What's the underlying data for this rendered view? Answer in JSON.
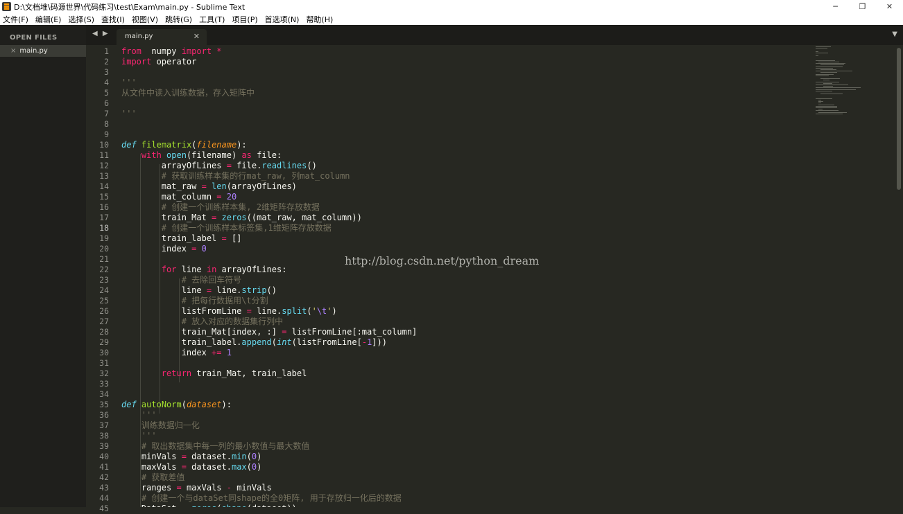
{
  "window": {
    "title": "D:\\文档堆\\码源世界\\代码练习\\test\\Exam\\main.py - Sublime Text",
    "controls": {
      "minimize": "─",
      "restore": "❐",
      "close": "✕"
    }
  },
  "menu": [
    "文件(F)",
    "编辑(E)",
    "选择(S)",
    "查找(I)",
    "视图(V)",
    "跳转(G)",
    "工具(T)",
    "项目(P)",
    "首选项(N)",
    "帮助(H)"
  ],
  "sidebar": {
    "header": "OPEN FILES",
    "files": [
      {
        "close": "×",
        "name": "main.py"
      }
    ]
  },
  "tabs": {
    "nav": "◀ ▶",
    "active": {
      "label": "main.py",
      "close": "✕"
    },
    "dropdown": "▼"
  },
  "editor": {
    "active_line": 18,
    "watermark": "http://blog.csdn.net/python_dream",
    "lines": [
      [
        [
          "kw",
          "from"
        ],
        [
          "",
          "  numpy "
        ],
        [
          "kw",
          "import"
        ],
        [
          "kw",
          " *"
        ]
      ],
      [
        [
          "kw",
          "import"
        ],
        [
          "",
          " operator"
        ]
      ],
      [],
      [
        [
          "doc",
          "'''"
        ]
      ],
      [
        [
          "doc",
          "从文件中读入训练数据，存入矩阵中"
        ]
      ],
      [],
      [
        [
          "doc",
          "'''"
        ]
      ],
      [],
      [],
      [
        [
          "def",
          "def"
        ],
        [
          "",
          " "
        ],
        [
          "fn",
          "filematrix"
        ],
        [
          "",
          "("
        ],
        [
          "param",
          "filename"
        ],
        [
          "",
          "):"
        ]
      ],
      [
        [
          "",
          "    "
        ],
        [
          "kw",
          "with"
        ],
        [
          "",
          " "
        ],
        [
          "bi",
          "open"
        ],
        [
          "",
          "(filename) "
        ],
        [
          "kw",
          "as"
        ],
        [
          "",
          " file:"
        ]
      ],
      [
        [
          "",
          "        arrayOfLines "
        ],
        [
          "kw",
          "="
        ],
        [
          "",
          " file."
        ],
        [
          "bi",
          "readlines"
        ],
        [
          "",
          "()"
        ]
      ],
      [
        [
          "",
          "        "
        ],
        [
          "cmt",
          "# 获取训练样本集的行mat_raw, 列mat_column"
        ]
      ],
      [
        [
          "",
          "        mat_raw "
        ],
        [
          "kw",
          "="
        ],
        [
          "",
          " "
        ],
        [
          "bi",
          "len"
        ],
        [
          "",
          "(arrayOfLines)"
        ]
      ],
      [
        [
          "",
          "        mat_column "
        ],
        [
          "kw",
          "="
        ],
        [
          "",
          " "
        ],
        [
          "num",
          "20"
        ]
      ],
      [
        [
          "",
          "        "
        ],
        [
          "cmt",
          "# 创建一个训练样本集, 2维矩阵存放数据"
        ]
      ],
      [
        [
          "",
          "        train_Mat "
        ],
        [
          "kw",
          "="
        ],
        [
          "",
          " "
        ],
        [
          "bi",
          "zeros"
        ],
        [
          "",
          "((mat_raw, mat_column))"
        ]
      ],
      [
        [
          "",
          "        "
        ],
        [
          "cmt",
          "# 创建一个训练样本标签集,1维矩阵存放数据"
        ]
      ],
      [
        [
          "",
          "        train_label "
        ],
        [
          "kw",
          "="
        ],
        [
          "",
          " []"
        ]
      ],
      [
        [
          "",
          "        index "
        ],
        [
          "kw",
          "="
        ],
        [
          "",
          " "
        ],
        [
          "num",
          "0"
        ]
      ],
      [],
      [
        [
          "",
          "        "
        ],
        [
          "kw",
          "for"
        ],
        [
          "",
          " line "
        ],
        [
          "kw",
          "in"
        ],
        [
          "",
          " arrayOfLines:"
        ]
      ],
      [
        [
          "",
          "            "
        ],
        [
          "cmt",
          "# 去除回车符号"
        ]
      ],
      [
        [
          "",
          "            line "
        ],
        [
          "kw",
          "="
        ],
        [
          "",
          " line."
        ],
        [
          "bi",
          "strip"
        ],
        [
          "",
          "()"
        ]
      ],
      [
        [
          "",
          "            "
        ],
        [
          "cmt",
          "# 把每行数据用\\t分割"
        ]
      ],
      [
        [
          "",
          "            listFromLine "
        ],
        [
          "kw",
          "="
        ],
        [
          "",
          " line."
        ],
        [
          "bi",
          "split"
        ],
        [
          "",
          "("
        ],
        [
          "str",
          "'"
        ],
        [
          "esc",
          "\\t"
        ],
        [
          "str",
          "'"
        ],
        [
          "",
          ")"
        ]
      ],
      [
        [
          "",
          "            "
        ],
        [
          "cmt",
          "# 放入对应的数据集行列中"
        ]
      ],
      [
        [
          "",
          "            train_Mat[index, :] "
        ],
        [
          "kw",
          "="
        ],
        [
          "",
          " listFromLine[:mat_column]"
        ]
      ],
      [
        [
          "",
          "            train_label."
        ],
        [
          "bi",
          "append"
        ],
        [
          "",
          "("
        ],
        [
          "def",
          "int"
        ],
        [
          "",
          "(listFromLine["
        ],
        [
          "kw",
          "-"
        ],
        [
          "num",
          "1"
        ],
        [
          "",
          "]))"
        ]
      ],
      [
        [
          "",
          "            index "
        ],
        [
          "kw",
          "+="
        ],
        [
          "",
          " "
        ],
        [
          "num",
          "1"
        ]
      ],
      [],
      [
        [
          "",
          "        "
        ],
        [
          "kw",
          "return"
        ],
        [
          "",
          " train_Mat, train_label"
        ]
      ],
      [],
      [],
      [
        [
          "def",
          "def"
        ],
        [
          "",
          " "
        ],
        [
          "fn",
          "autoNorm"
        ],
        [
          "",
          "("
        ],
        [
          "param",
          "dataset"
        ],
        [
          "",
          "):"
        ]
      ],
      [
        [
          "",
          "    "
        ],
        [
          "doc",
          "'''"
        ]
      ],
      [
        [
          "",
          "    "
        ],
        [
          "doc",
          "训练数据归一化"
        ]
      ],
      [
        [
          "",
          "    "
        ],
        [
          "doc",
          "'''"
        ]
      ],
      [
        [
          "",
          "    "
        ],
        [
          "cmt",
          "# 取出数据集中每一列的最小数值与最大数值"
        ]
      ],
      [
        [
          "",
          "    minVals "
        ],
        [
          "kw",
          "="
        ],
        [
          "",
          " dataset."
        ],
        [
          "bi",
          "min"
        ],
        [
          "",
          "("
        ],
        [
          "num",
          "0"
        ],
        [
          "",
          ")"
        ]
      ],
      [
        [
          "",
          "    maxVals "
        ],
        [
          "kw",
          "="
        ],
        [
          "",
          " dataset."
        ],
        [
          "bi",
          "max"
        ],
        [
          "",
          "("
        ],
        [
          "num",
          "0"
        ],
        [
          "",
          ")"
        ]
      ],
      [
        [
          "",
          "    "
        ],
        [
          "cmt",
          "# 获取差值"
        ]
      ],
      [
        [
          "",
          "    ranges "
        ],
        [
          "kw",
          "="
        ],
        [
          "",
          " maxVals "
        ],
        [
          "kw",
          "-"
        ],
        [
          "",
          " minVals"
        ]
      ],
      [
        [
          "",
          "    "
        ],
        [
          "cmt",
          "# 创建一个与dataSet同shape的全0矩阵, 用于存放归一化后的数据"
        ]
      ],
      [
        [
          "",
          "    DataSet "
        ],
        [
          "kw",
          "="
        ],
        [
          "",
          " "
        ],
        [
          "bi",
          "zeros"
        ],
        [
          "",
          "("
        ],
        [
          "bi",
          "shape"
        ],
        [
          "",
          "(dataset))"
        ]
      ]
    ]
  }
}
